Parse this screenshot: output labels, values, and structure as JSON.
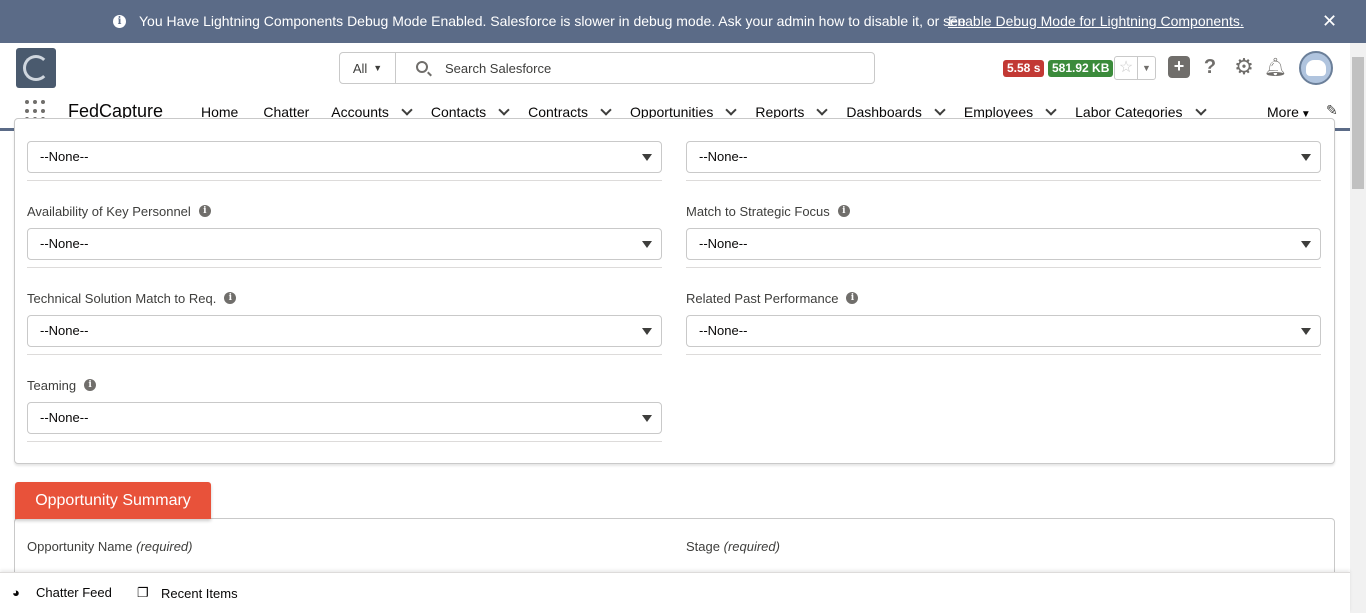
{
  "banner": {
    "message": "You Have Lightning Components Debug Mode Enabled. Salesforce is slower in debug mode. Ask your admin how to disable it, or see",
    "link": "Enable Debug Mode for Lightning Components.",
    "close": "✕"
  },
  "header": {
    "search_scope": "All",
    "search_placeholder": "Search Salesforce",
    "perf_time": "5.58 s",
    "perf_memory": "581.92 KB"
  },
  "nav": {
    "app_name": "FedCapture",
    "items": [
      {
        "label": "Home",
        "dropdown": false
      },
      {
        "label": "Chatter",
        "dropdown": false
      },
      {
        "label": "Accounts",
        "dropdown": true
      },
      {
        "label": "Contacts",
        "dropdown": true
      },
      {
        "label": "Contracts",
        "dropdown": true
      },
      {
        "label": "Opportunities",
        "dropdown": true
      },
      {
        "label": "Reports",
        "dropdown": true
      },
      {
        "label": "Dashboards",
        "dropdown": true
      },
      {
        "label": "Employees",
        "dropdown": true
      },
      {
        "label": "Labor Categories",
        "dropdown": true
      }
    ],
    "more": "More"
  },
  "form": {
    "top_left_value": "--None--",
    "top_right_value": "--None--",
    "fields": [
      {
        "label": "Availability of Key Personnel",
        "value": "--None--"
      },
      {
        "label": "Match to Strategic Focus",
        "value": "--None--"
      },
      {
        "label": "Technical Solution Match to Req.",
        "value": "--None--"
      },
      {
        "label": "Related Past Performance",
        "value": "--None--"
      },
      {
        "label": "Teaming",
        "value": "--None--"
      }
    ]
  },
  "summary": {
    "section_title": "Opportunity Summary",
    "name_label": "Opportunity Name",
    "stage_label": "Stage",
    "required_text": "(required)"
  },
  "utility": {
    "chatter_feed": "Chatter Feed",
    "recent_items": "Recent Items"
  },
  "colors": {
    "banner_bg": "#5b6b87",
    "section_accent": "#e8523a",
    "perf_time_bg": "#c23934",
    "perf_memory_bg": "#3b8b3b"
  }
}
